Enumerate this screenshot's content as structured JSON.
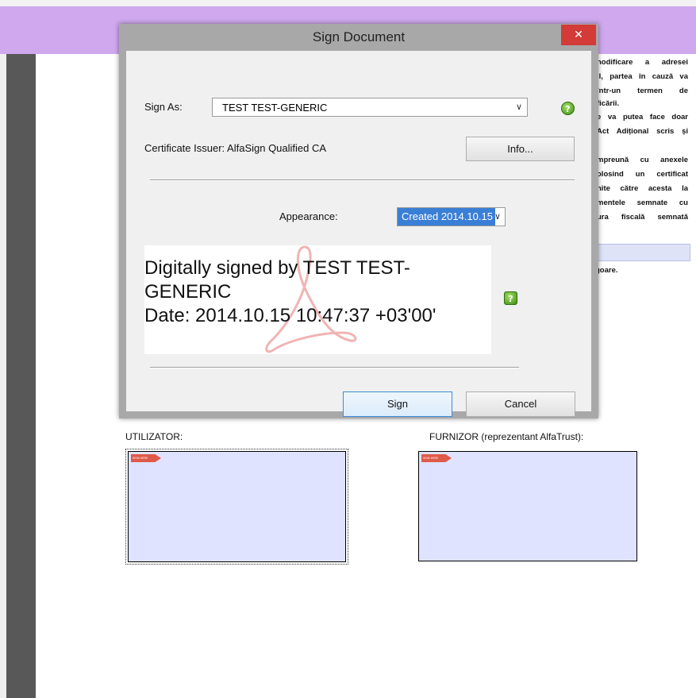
{
  "dialog": {
    "title": "Sign Document",
    "close_glyph": "✕",
    "sign_as_label": "Sign As:",
    "sign_as_value": "TEST TEST-GENERIC",
    "certificate_issuer": "Certificate Issuer: AlfaSign Qualified CA",
    "info_button": "Info...",
    "appearance_label": "Appearance:",
    "appearance_value": "Created 2014.10.15",
    "preview": {
      "line1": "Digitally signed by TEST TEST-",
      "line2": "GENERIC",
      "line3": "Date: 2014.10.15 10:47:37 +03'00'"
    },
    "sign_button": "Sign",
    "cancel_button": "Cancel",
    "help_glyph": "?"
  },
  "document": {
    "text_lines": [
      "nodificare a adresei",
      "il, partea în cauză va",
      "într-un termen de",
      "ficării.",
      "e va putea face doar",
      "Act Adițional scris și",
      "mpreună cu anexele",
      "olosind un certificat",
      "nite către acesta la",
      "mentele semnate cu",
      "ura fiscală semnată"
    ],
    "extra_text": "goare.",
    "signatures": {
      "left_label": "UTILIZATOR:",
      "right_label": "FURNIZOR (reprezentant AlfaTrust):",
      "tag_text": "SIGN HERE"
    }
  },
  "colors": {
    "header": "#cfa8ee",
    "close_button": "#d23b38",
    "selection": "#3a7fd6",
    "signature_field": "#dfe3ff",
    "help_icon": "#3e8e12"
  },
  "icons": [
    "close-icon",
    "chevron-down-icon",
    "help-icon",
    "acrobat-watermark-icon",
    "sign-here-tag-icon"
  ]
}
